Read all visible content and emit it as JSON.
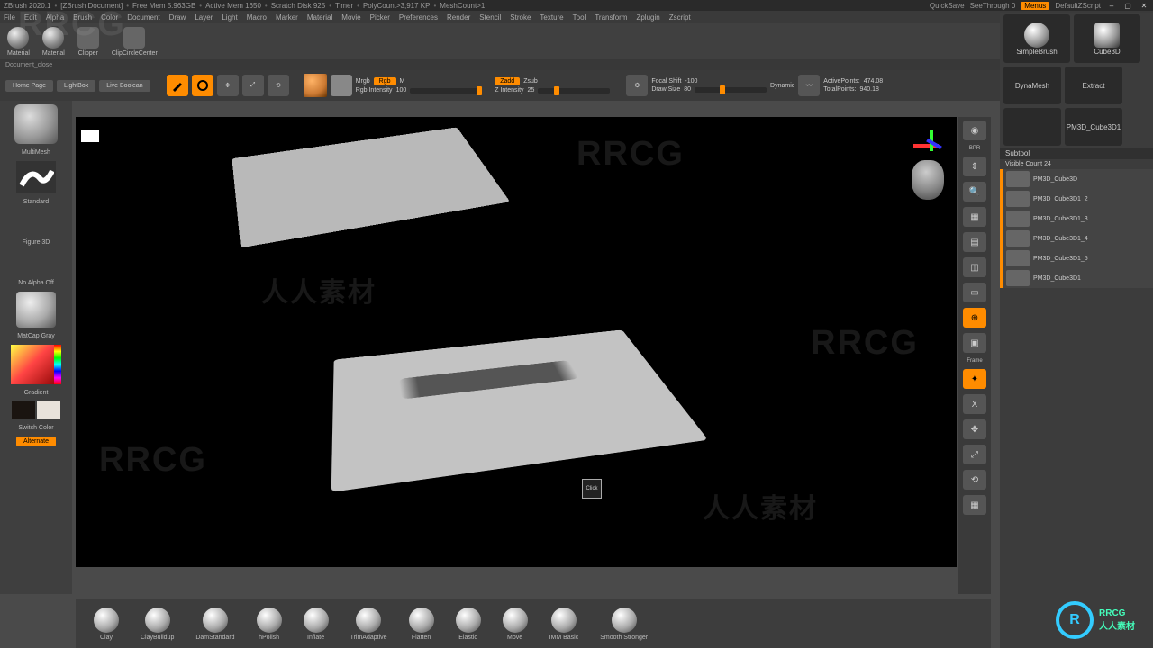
{
  "title": {
    "app": "ZBrush 2020.1",
    "doc": "[ZBrush Document]",
    "mem": "Free Mem 5.963GB",
    "active": "Active Mem 1650",
    "scratch": "Scratch Disk 925",
    "timer": "Timer",
    "poly": "PolyCount>3,917 KP",
    "mesh": "MeshCount>1",
    "quicksave": "QuickSave",
    "seethrough": "SeeThrough 0",
    "menus": "Menus",
    "script": "DefaultZScript"
  },
  "menu": [
    "File",
    "Edit",
    "Alpha",
    "Brush",
    "Color",
    "Document",
    "Draw",
    "Layer",
    "Light",
    "Macro",
    "Marker",
    "Material",
    "Movie",
    "Picker",
    "Preferences",
    "Render",
    "Stencil",
    "Stroke",
    "Texture",
    "Tool",
    "Transform",
    "Zplugin",
    "Zscript"
  ],
  "shelf": [
    {
      "label": "Material"
    },
    {
      "label": "Material"
    },
    {
      "label": "Clipper"
    },
    {
      "label": "ClipCircleCenter"
    }
  ],
  "doc_row": "Document_close",
  "ctrl": {
    "home": "Home Page",
    "lightbox": "LightBox",
    "live": "Live Boolean",
    "edit": "Edit",
    "draw": "Draw",
    "move": "Move",
    "scale": "Scale",
    "rotate": "Rotate",
    "mrgb": "Mrgb",
    "rgb": "Rgb",
    "m": "M",
    "rgb_int_label": "Rgb Intensity",
    "rgb_int_value": "100",
    "zadd": "Zadd",
    "zsub": "Zsub",
    "zint_label": "Z Intensity",
    "zint_value": "25",
    "focal_label": "Focal Shift",
    "focal_value": "-100",
    "draw_label": "Draw Size",
    "draw_value": "80",
    "dynamic": "Dynamic",
    "ap_label": "ActivePoints:",
    "ap_value": "474.08",
    "tp_label": "TotalPoints:",
    "tp_value": "940.18"
  },
  "left": {
    "tool": "MultiMesh",
    "brush": "Standard",
    "stroke": "Figure 3D",
    "alpha": "No Alpha Off",
    "mat": "MatCap Gray",
    "grad": "Gradient",
    "switch": "Switch Color",
    "alt": "Alternate"
  },
  "right_strip": [
    {
      "label": "BPR",
      "on": false
    },
    {
      "label": "Scroll",
      "on": false
    },
    {
      "label": "Zoom",
      "on": false
    },
    {
      "label": "Actual",
      "on": false
    },
    {
      "label": "AAHalf",
      "on": false
    },
    {
      "label": "Persp",
      "on": false
    },
    {
      "label": "Floor",
      "on": false
    },
    {
      "label": "Local",
      "on": true
    },
    {
      "label": "Frame",
      "on": false
    },
    {
      "label": "Xpose",
      "on": true
    },
    {
      "label": "X",
      "on": false
    },
    {
      "label": "Move",
      "on": false
    },
    {
      "label": "Scale",
      "on": false
    },
    {
      "label": "Rotate",
      "on": false
    },
    {
      "label": "PolyF",
      "on": false
    }
  ],
  "tools": {
    "main": "SimpleBrush",
    "sec": "Cube3D",
    "small": [
      "DynaMesh",
      "Extract",
      "",
      "PM3D_Cube3D1"
    ]
  },
  "subtool": {
    "head": "Subtool",
    "visible": "Visible Count 24",
    "items": [
      "PM3D_Cube3D",
      "PM3D_Cube3D1_2",
      "PM3D_Cube3D1_3",
      "PM3D_Cube3D1_4",
      "PM3D_Cube3D1_5",
      "PM3D_Cube3D1"
    ]
  },
  "brush_tray": [
    "Clay",
    "ClayBuildup",
    "DamStandard",
    "hPolish",
    "Inflate",
    "TrimAdaptive",
    "Flatten",
    "Elastic",
    "Move",
    "IMM Basic",
    "Smooth Stronger"
  ],
  "watermark": "RRCG",
  "watermark2": "人人素材",
  "cursor": "Click"
}
